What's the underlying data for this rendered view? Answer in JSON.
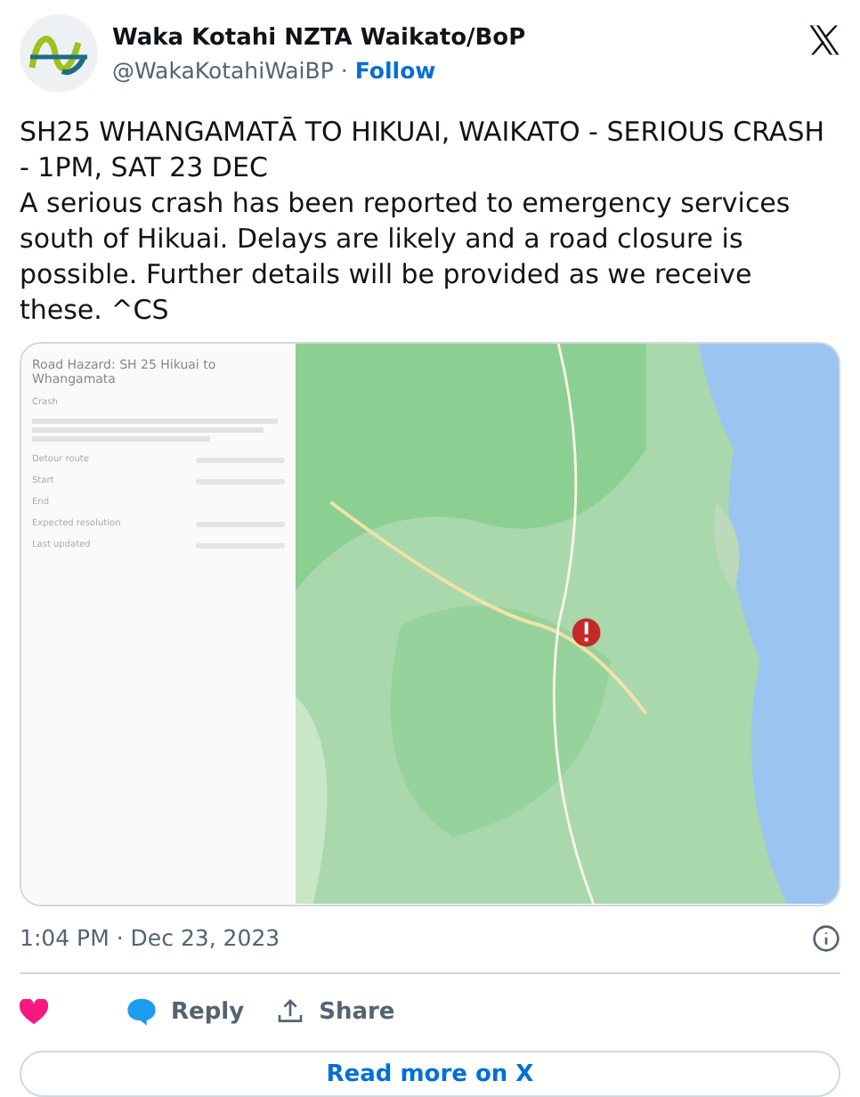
{
  "author": {
    "name": "Waka Kotahi NZTA Waikato/BoP",
    "handle": "@WakaKotahiWaiBP",
    "separator": "·",
    "follow": "Follow"
  },
  "text": {
    "headline": "SH25 WHANGAMATĀ TO HIKUAI, WAIKATO - SERIOUS CRASH - 1PM, SAT 23 DEC",
    "body": "A serious crash has been reported to emergency services south of Hikuai. Delays are likely and a road closure is possible. Further details will be provided as we receive these. ^CS"
  },
  "media": {
    "panel": {
      "title": "Road Hazard: SH 25 Hikuai to Whangamata",
      "type": "Crash",
      "fields": [
        "Detour route",
        "Start",
        "End",
        "Expected resolution",
        "Last updated"
      ]
    }
  },
  "timestamp": "1:04 PM · Dec 23, 2023",
  "actions": [
    {
      "kind": "like"
    },
    {
      "kind": "reply",
      "label": "Reply"
    },
    {
      "kind": "share",
      "label": "Share"
    }
  ],
  "read_more": "Read more on X"
}
